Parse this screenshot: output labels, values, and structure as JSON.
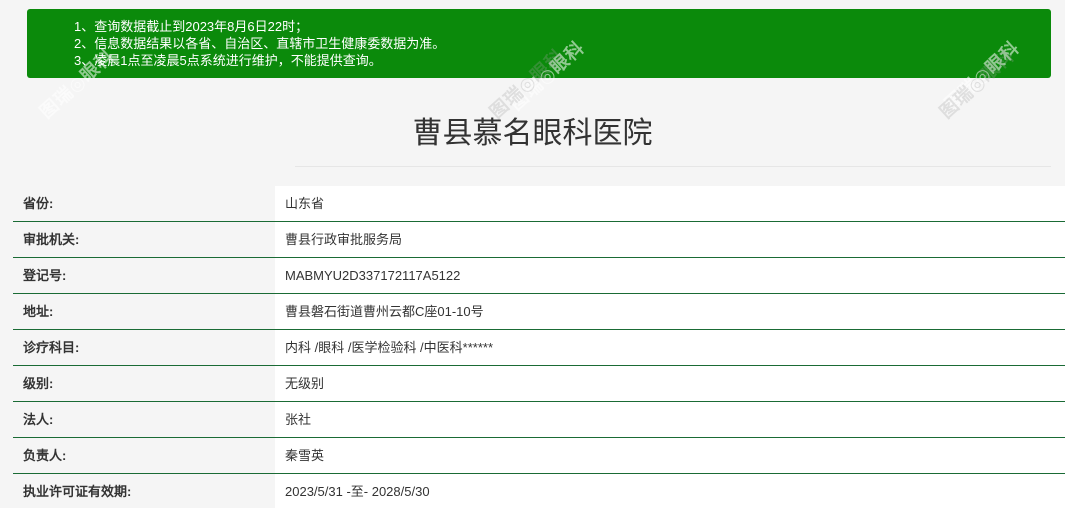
{
  "notice": {
    "lines": [
      "1、查询数据截止到2023年8月6日22时；",
      "2、信息数据结果以各省、自治区、直辖市卫生健康委数据为准。",
      "3、凌晨1点至凌晨5点系统进行维护，不能提供查询。"
    ],
    "background_color": "#0b8a0b"
  },
  "watermark": {
    "text": "图瑞◎眼科"
  },
  "hospital": {
    "name": "曹县慕名眼科医院"
  },
  "details": [
    {
      "label": "省份:",
      "value": "山东省"
    },
    {
      "label": "审批机关:",
      "value": "曹县行政审批服务局"
    },
    {
      "label": "登记号:",
      "value": "MABMYU2D337172117A5122"
    },
    {
      "label": "地址:",
      "value": "曹县磐石街道曹州云都C座01-10号"
    },
    {
      "label": "诊疗科目:",
      "value": "内科 /眼科 /医学检验科 /中医科******"
    },
    {
      "label": "级别:",
      "value": "无级别"
    },
    {
      "label": "法人:",
      "value": "张社"
    },
    {
      "label": "负责人:",
      "value": "秦雪英"
    },
    {
      "label": "执业许可证有效期:",
      "value": "2023/5/31 -至- 2028/5/30"
    }
  ],
  "colors": {
    "row_divider": "#1a6b35",
    "label_background": "#f5f5f5",
    "value_background": "#ffffff"
  }
}
